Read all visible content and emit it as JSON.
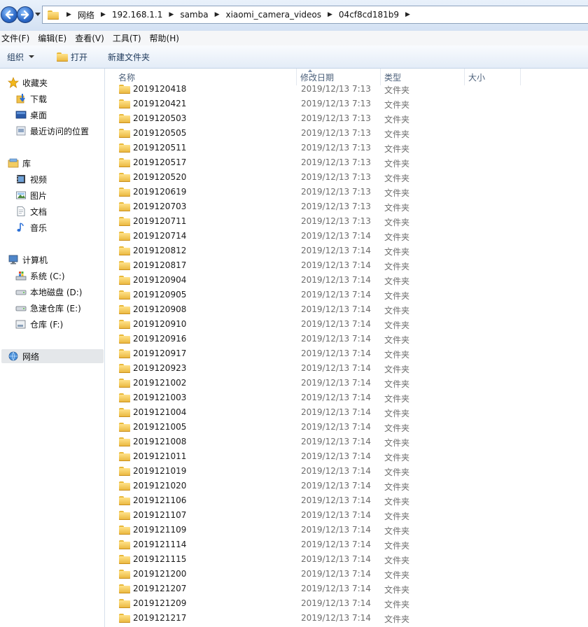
{
  "address_bar": {
    "path": [
      "网络",
      "192.168.1.1",
      "samba",
      "xiaomi_camera_videos",
      "04cf8cd181b9"
    ]
  },
  "menu": [
    "文件(F)",
    "编辑(E)",
    "查看(V)",
    "工具(T)",
    "帮助(H)"
  ],
  "toolbar": {
    "organize": "组织",
    "open": "打开",
    "new_folder": "新建文件夹"
  },
  "nav": {
    "favorites": {
      "label": "收藏夹",
      "items": [
        "下载",
        "桌面",
        "最近访问的位置"
      ]
    },
    "libraries": {
      "label": "库",
      "items": [
        "视频",
        "图片",
        "文档",
        "音乐"
      ]
    },
    "computer": {
      "label": "计算机",
      "items": [
        "系统 (C:)",
        "本地磁盘 (D:)",
        "急速仓库 (E:)",
        "仓库 (F:)"
      ]
    },
    "network": {
      "label": "网络"
    }
  },
  "columns": {
    "name": "名称",
    "date": "修改日期",
    "type": "类型",
    "size": "大小"
  },
  "files": [
    {
      "name": "2019120418",
      "date": "2019/12/13 7:13",
      "type": "文件夹"
    },
    {
      "name": "2019120421",
      "date": "2019/12/13 7:13",
      "type": "文件夹"
    },
    {
      "name": "2019120503",
      "date": "2019/12/13 7:13",
      "type": "文件夹"
    },
    {
      "name": "2019120505",
      "date": "2019/12/13 7:13",
      "type": "文件夹"
    },
    {
      "name": "2019120511",
      "date": "2019/12/13 7:13",
      "type": "文件夹"
    },
    {
      "name": "2019120517",
      "date": "2019/12/13 7:13",
      "type": "文件夹"
    },
    {
      "name": "2019120520",
      "date": "2019/12/13 7:13",
      "type": "文件夹"
    },
    {
      "name": "2019120619",
      "date": "2019/12/13 7:13",
      "type": "文件夹"
    },
    {
      "name": "2019120703",
      "date": "2019/12/13 7:13",
      "type": "文件夹"
    },
    {
      "name": "2019120711",
      "date": "2019/12/13 7:13",
      "type": "文件夹"
    },
    {
      "name": "2019120714",
      "date": "2019/12/13 7:14",
      "type": "文件夹"
    },
    {
      "name": "2019120812",
      "date": "2019/12/13 7:14",
      "type": "文件夹"
    },
    {
      "name": "2019120817",
      "date": "2019/12/13 7:14",
      "type": "文件夹"
    },
    {
      "name": "2019120904",
      "date": "2019/12/13 7:14",
      "type": "文件夹"
    },
    {
      "name": "2019120905",
      "date": "2019/12/13 7:14",
      "type": "文件夹"
    },
    {
      "name": "2019120908",
      "date": "2019/12/13 7:14",
      "type": "文件夹"
    },
    {
      "name": "2019120910",
      "date": "2019/12/13 7:14",
      "type": "文件夹"
    },
    {
      "name": "2019120916",
      "date": "2019/12/13 7:14",
      "type": "文件夹"
    },
    {
      "name": "2019120917",
      "date": "2019/12/13 7:14",
      "type": "文件夹"
    },
    {
      "name": "2019120923",
      "date": "2019/12/13 7:14",
      "type": "文件夹"
    },
    {
      "name": "2019121002",
      "date": "2019/12/13 7:14",
      "type": "文件夹"
    },
    {
      "name": "2019121003",
      "date": "2019/12/13 7:14",
      "type": "文件夹"
    },
    {
      "name": "2019121004",
      "date": "2019/12/13 7:14",
      "type": "文件夹"
    },
    {
      "name": "2019121005",
      "date": "2019/12/13 7:14",
      "type": "文件夹"
    },
    {
      "name": "2019121008",
      "date": "2019/12/13 7:14",
      "type": "文件夹"
    },
    {
      "name": "2019121011",
      "date": "2019/12/13 7:14",
      "type": "文件夹"
    },
    {
      "name": "2019121019",
      "date": "2019/12/13 7:14",
      "type": "文件夹"
    },
    {
      "name": "2019121020",
      "date": "2019/12/13 7:14",
      "type": "文件夹"
    },
    {
      "name": "2019121106",
      "date": "2019/12/13 7:14",
      "type": "文件夹"
    },
    {
      "name": "2019121107",
      "date": "2019/12/13 7:14",
      "type": "文件夹"
    },
    {
      "name": "2019121109",
      "date": "2019/12/13 7:14",
      "type": "文件夹"
    },
    {
      "name": "2019121114",
      "date": "2019/12/13 7:14",
      "type": "文件夹"
    },
    {
      "name": "2019121115",
      "date": "2019/12/13 7:14",
      "type": "文件夹"
    },
    {
      "name": "2019121200",
      "date": "2019/12/13 7:14",
      "type": "文件夹"
    },
    {
      "name": "2019121207",
      "date": "2019/12/13 7:14",
      "type": "文件夹"
    },
    {
      "name": "2019121209",
      "date": "2019/12/13 7:14",
      "type": "文件夹"
    },
    {
      "name": "2019121217",
      "date": "2019/12/13 7:14",
      "type": "文件夹"
    }
  ]
}
